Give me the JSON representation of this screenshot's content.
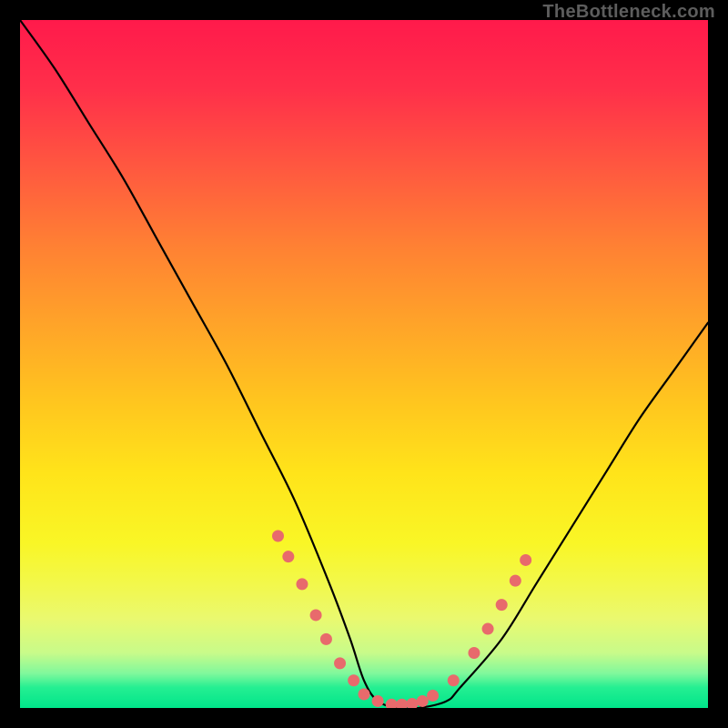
{
  "watermark": {
    "text": "TheBottleneck.com"
  },
  "chart_data": {
    "type": "line",
    "title": "",
    "xlabel": "",
    "ylabel": "",
    "xlim": [
      0,
      100
    ],
    "ylim": [
      0,
      100
    ],
    "grid": false,
    "legend": false,
    "series": [
      {
        "name": "bottleneck-curve",
        "x": [
          0,
          5,
          10,
          15,
          20,
          25,
          30,
          35,
          40,
          45,
          48,
          50,
          52,
          55,
          58,
          62,
          64,
          70,
          75,
          80,
          85,
          90,
          95,
          100
        ],
        "y": [
          100,
          93,
          85,
          77,
          68,
          59,
          50,
          40,
          30,
          18,
          10,
          4,
          1,
          0,
          0,
          1,
          3,
          10,
          18,
          26,
          34,
          42,
          49,
          56
        ]
      }
    ],
    "beads": {
      "name": "highlighted-points",
      "x": [
        37.5,
        39.0,
        41.0,
        43.0,
        44.5,
        46.5,
        48.5,
        50.0,
        52.0,
        54.0,
        55.5,
        57.0,
        58.5,
        60.0,
        63.0,
        66.0,
        68.0,
        70.0,
        72.0,
        73.5
      ],
      "y": [
        25.0,
        22.0,
        18.0,
        13.5,
        10.0,
        6.5,
        4.0,
        2.0,
        1.0,
        0.5,
        0.5,
        0.6,
        1.0,
        1.8,
        4.0,
        8.0,
        11.5,
        15.0,
        18.5,
        21.5
      ]
    },
    "background": {
      "type": "vertical-gradient",
      "stops": [
        {
          "pos": 0.0,
          "color": "#ff1a4b"
        },
        {
          "pos": 0.33,
          "color": "#ff8133"
        },
        {
          "pos": 0.66,
          "color": "#ffe41a"
        },
        {
          "pos": 0.95,
          "color": "#7ff89c"
        },
        {
          "pos": 1.0,
          "color": "#00e58a"
        }
      ]
    }
  }
}
